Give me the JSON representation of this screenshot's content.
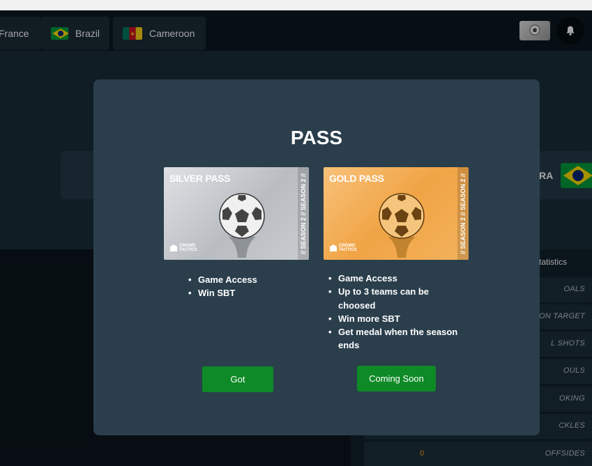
{
  "header": {
    "tabs": [
      {
        "label": "France",
        "flag": "france-flag"
      },
      {
        "label": "Brazil",
        "flag": "brazil-flag"
      },
      {
        "label": "Cameroon",
        "flag": "cameroon-flag"
      }
    ],
    "notification_icon": "bell-icon"
  },
  "background": {
    "team_code": "RA",
    "stats_header": "tatistics",
    "stats": [
      {
        "label": "OALS",
        "value": ""
      },
      {
        "label": "ON TARGET",
        "value": ""
      },
      {
        "label": "L SHOTS",
        "value": ""
      },
      {
        "label": "OULS",
        "value": ""
      },
      {
        "label": "OKING",
        "value": ""
      },
      {
        "label": "CKLES",
        "value": ""
      },
      {
        "label": "OFFSIDES",
        "value": "0"
      }
    ]
  },
  "modal": {
    "title": "PASS",
    "silver": {
      "name": "SILVER PASS",
      "side_text": "// SEASON 2 // SEASON 2 //",
      "logo_text": "CROWD TACTICS",
      "features": [
        "Game Access",
        "Win SBT"
      ],
      "button_label": "Got"
    },
    "gold": {
      "name": "GOLD PASS",
      "side_text": "// SEASON 2 // SEASON 2 //",
      "logo_text": "CROWD TACTICS",
      "features": [
        "Game Access",
        "Up to 3 teams can be choosed",
        "Win more SBT",
        "Get medal when the season ends"
      ],
      "button_label": "Coming Soon"
    }
  },
  "colors": {
    "modal_bg": "#2a3e4c",
    "button_green": "#0e8a26",
    "gold": "#f0a445",
    "silver": "#c4c7cb",
    "accent_value": "#f2a51e"
  }
}
